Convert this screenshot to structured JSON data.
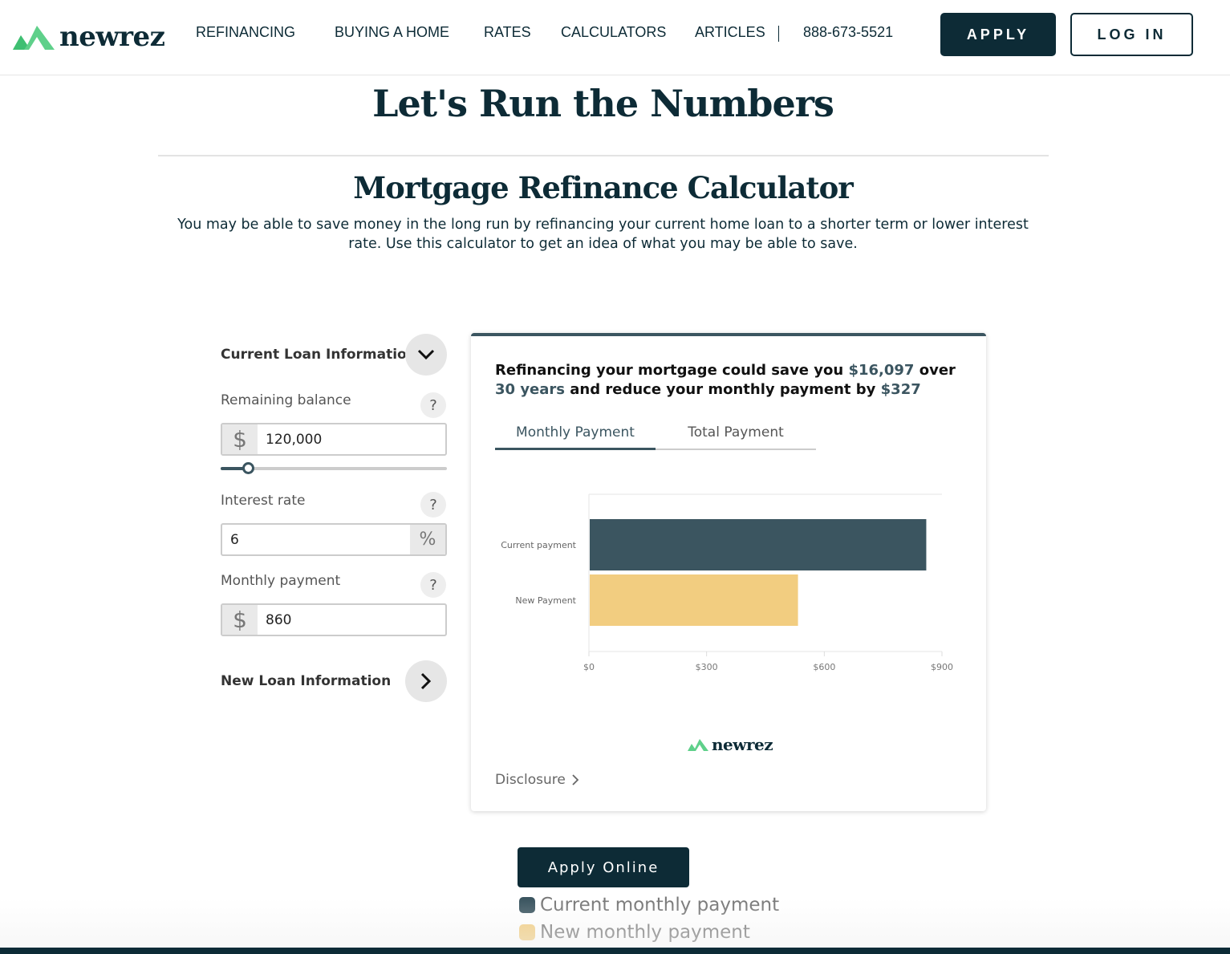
{
  "header": {
    "logo_text": "newrez",
    "nav": [
      "REFINANCING",
      "BUYING A HOME",
      "RATES",
      "CALCULATORS",
      "ARTICLES"
    ],
    "phone": "888-673-5521",
    "apply_label": "APPLY",
    "login_label": "LOG IN"
  },
  "page": {
    "title": "Let's Run the Numbers",
    "calc_title": "Mortgage Refinance Calculator",
    "intro": "You may be able to save money in the long run by refinancing your current home loan to a shorter term or lower interest rate. Use this calculator to get an idea of what you may be able to save."
  },
  "form": {
    "current_section": "Current Loan Information",
    "new_section": "New Loan Information",
    "fields": [
      {
        "label": "Remaining balance",
        "adornment": "$",
        "value": "120,000",
        "help": "?"
      },
      {
        "label": "Interest rate",
        "adornment": "%",
        "value": "6",
        "help": "?"
      },
      {
        "label": "Monthly payment",
        "adornment": "$",
        "value": "860",
        "help": "?"
      }
    ],
    "balance_slider_fraction": 0.12
  },
  "results": {
    "headline_1": "Refinancing your mortgage could save you ",
    "savings": "$16,097",
    "headline_2": " over ",
    "term": "30 years",
    "headline_3": " and reduce your monthly payment by ",
    "monthly_savings": "$327",
    "tabs": [
      "Monthly Payment",
      "Total Payment"
    ],
    "active_tab": 0,
    "logo_text": "newrez",
    "disclosure": "Disclosure"
  },
  "chart_data": {
    "type": "bar",
    "orientation": "horizontal",
    "categories": [
      "Current payment",
      "New Payment"
    ],
    "values": [
      860,
      533
    ],
    "colors": [
      "#3b5560",
      "#f2cd80"
    ],
    "xlim": [
      0,
      900
    ],
    "xticks": [
      "$0",
      "$300",
      "$600",
      "$900"
    ],
    "xtick_values": [
      0,
      300,
      600,
      900
    ]
  },
  "cta": {
    "apply_online": "Apply Online"
  },
  "legend": [
    {
      "label": "Current monthly payment",
      "color": "#3b5560"
    },
    {
      "label": "New monthly payment",
      "color": "#f2cd80"
    }
  ],
  "colors": {
    "brand_dark": "#0d2b36",
    "accent_slate": "#3b5560",
    "accent_gold": "#f2cd80",
    "logo_green": "#5fd08a"
  }
}
